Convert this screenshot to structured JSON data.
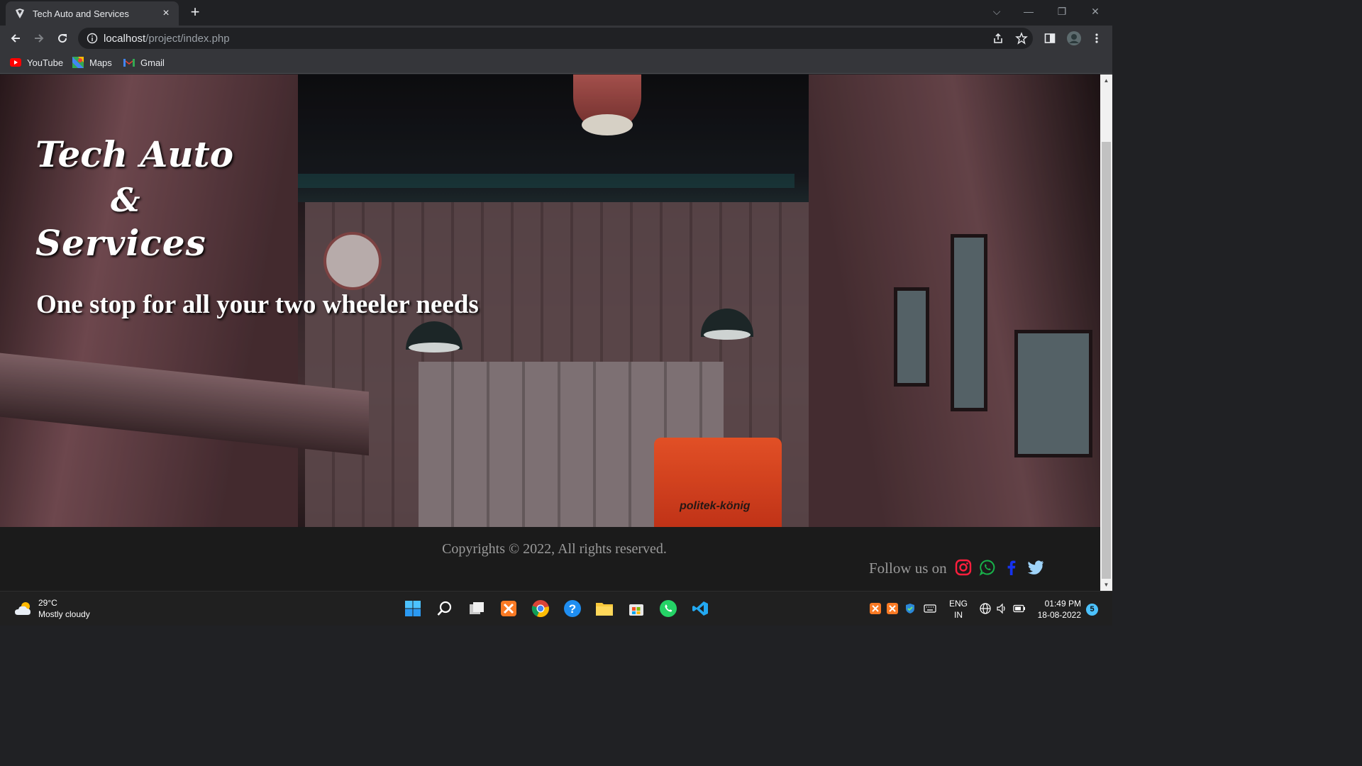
{
  "browser": {
    "tab_title": "Tech Auto and Services",
    "tab_close": "×",
    "new_tab": "+",
    "address_host": "localhost",
    "address_path": "/project/index.php",
    "bookmarks": [
      {
        "label": "YouTube",
        "icon": "youtube-icon"
      },
      {
        "label": "Maps",
        "icon": "maps-icon"
      },
      {
        "label": "Gmail",
        "icon": "gmail-icon"
      }
    ]
  },
  "hero": {
    "title_line1": "Tech Auto",
    "title_line2": "&",
    "title_line3": "Services",
    "tagline": "One stop for all your two wheeler needs",
    "engine_label": "politek-könig"
  },
  "footer": {
    "copyright": "Copyrights © 2022, All rights reserved.",
    "follow": "Follow us on",
    "socials": [
      "instagram-icon",
      "whatsapp-icon",
      "facebook-icon",
      "twitter-icon"
    ]
  },
  "taskbar": {
    "weather_temp": "29°C",
    "weather_desc": "Mostly cloudy",
    "lang_line1": "ENG",
    "lang_line2": "IN",
    "time": "01:49 PM",
    "date": "18-08-2022",
    "notification_count": "5"
  },
  "colors": {
    "instagram": "#e1306c",
    "whatsapp": "#25d366",
    "facebook": "#1877f2",
    "twitter": "#1da1f2",
    "engine": "#ff4f1f"
  }
}
